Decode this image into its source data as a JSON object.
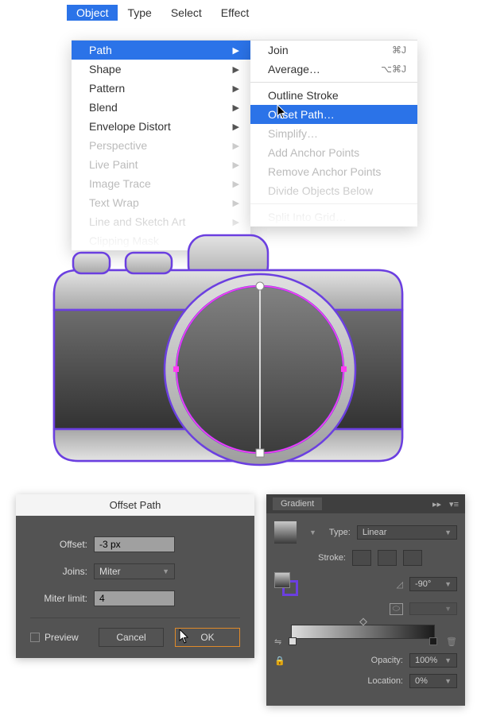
{
  "menubar": {
    "items": [
      "Object",
      "Type",
      "Select",
      "Effect"
    ],
    "active": "Object"
  },
  "menu1": {
    "items": [
      {
        "label": "Path",
        "dim": false,
        "hl": true,
        "arrow": true
      },
      {
        "label": "Shape",
        "dim": false,
        "hl": false,
        "arrow": true
      },
      {
        "label": "Pattern",
        "dim": false,
        "hl": false,
        "arrow": true
      },
      {
        "label": "Blend",
        "dim": false,
        "hl": false,
        "arrow": true
      },
      {
        "label": "Envelope Distort",
        "dim": false,
        "hl": false,
        "arrow": true
      },
      {
        "label": "Perspective",
        "dim": true,
        "hl": false,
        "arrow": true
      },
      {
        "label": "Live Paint",
        "dim": true,
        "hl": false,
        "arrow": true
      },
      {
        "label": "Image Trace",
        "dim": true,
        "hl": false,
        "arrow": true
      },
      {
        "label": "Text Wrap",
        "dim": true,
        "hl": false,
        "arrow": true
      },
      {
        "label": "Line and Sketch Art",
        "dim": true,
        "hl": false,
        "arrow": true
      },
      {
        "label": "Clipping Mask",
        "dim": true,
        "hl": false,
        "arrow": true
      }
    ]
  },
  "menu2": {
    "items": [
      {
        "label": "Join",
        "sc": "⌘J",
        "dim": false,
        "hl": false
      },
      {
        "label": "Average…",
        "sc": "⌥⌘J",
        "dim": false,
        "hl": false
      },
      {
        "sep": true
      },
      {
        "label": "Outline Stroke",
        "sc": "",
        "dim": false,
        "hl": false
      },
      {
        "label": "Offset Path…",
        "sc": "",
        "dim": false,
        "hl": true
      },
      {
        "label": "Simplify…",
        "sc": "",
        "dim": true,
        "hl": false
      },
      {
        "label": "Add Anchor Points",
        "sc": "",
        "dim": true,
        "hl": false
      },
      {
        "label": "Remove Anchor Points",
        "sc": "",
        "dim": true,
        "hl": false
      },
      {
        "label": "Divide Objects Below",
        "sc": "",
        "dim": true,
        "hl": false
      },
      {
        "sep": true
      },
      {
        "label": "Split Into Grid…",
        "sc": "",
        "dim": true,
        "hl": false
      }
    ]
  },
  "offset_dialog": {
    "title": "Offset Path",
    "offset_label": "Offset:",
    "offset_value": "-3 px",
    "joins_label": "Joins:",
    "joins_value": "Miter",
    "miter_label": "Miter limit:",
    "miter_value": "4",
    "preview_label": "Preview",
    "cancel": "Cancel",
    "ok": "OK"
  },
  "gradient_panel": {
    "title": "Gradient",
    "type_label": "Type:",
    "type_value": "Linear",
    "stroke_label": "Stroke:",
    "angle_value": "-90°",
    "aspect_value": "",
    "opacity_label": "Opacity:",
    "opacity_value": "100%",
    "location_label": "Location:",
    "location_value": "0%"
  }
}
